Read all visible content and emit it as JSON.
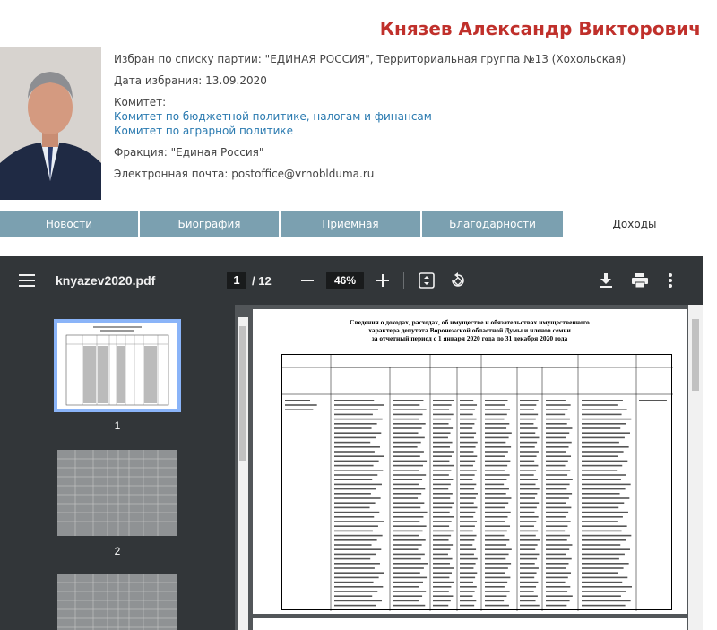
{
  "deputy": {
    "name": "Князев Александр Викторович",
    "party_label": "Избран по списку партии:",
    "party_value": "\"ЕДИНАЯ РОССИЯ\", Территориальная группа №13 (Хохольская)",
    "election_label": "Дата избрания:",
    "election_value": "13.09.2020",
    "committee_label": "Комитет:",
    "committees": [
      "Комитет по бюджетной политике, налогам и финансам",
      "Комитет по аграрной политике"
    ],
    "faction_label": "Фракция:",
    "faction_value": "\"Единая Россия\"",
    "email_label": "Электронная почта:",
    "email_value": "postoffice@vrnoblduma.ru"
  },
  "tabs": [
    {
      "label": "Новости",
      "active": false
    },
    {
      "label": "Биография",
      "active": false
    },
    {
      "label": "Приемная",
      "active": false
    },
    {
      "label": "Благодарности",
      "active": false
    },
    {
      "label": "Доходы",
      "active": true
    }
  ],
  "viewer": {
    "filename": "knyazev2020.pdf",
    "current_page": "1",
    "total_pages": "/ 12",
    "zoom": "46%",
    "thumbnails": [
      "1",
      "2"
    ],
    "icons": {
      "menu": "menu-icon",
      "zoom_out": "minus-icon",
      "zoom_in": "plus-icon",
      "fit": "fit-page-icon",
      "rotate": "rotate-icon",
      "download": "download-icon",
      "print": "print-icon",
      "more": "more-vert-icon"
    }
  },
  "document": {
    "title_lines": [
      "Сведения о доходах, расходах, об имуществе и обязательствах имущественного",
      "характера депутата Воронежской областной Думы и членов семьи",
      "за отчетный период с 1 января 2020 года по 31 декабря 2020 года"
    ]
  },
  "colors": {
    "name_red": "#c0302b",
    "tab_bg": "#7ba0b0",
    "link_blue": "#2a7ab0",
    "toolbar_bg": "#323639",
    "viewer_bg": "#525659",
    "thumb_selected": "#8ab4f8"
  }
}
